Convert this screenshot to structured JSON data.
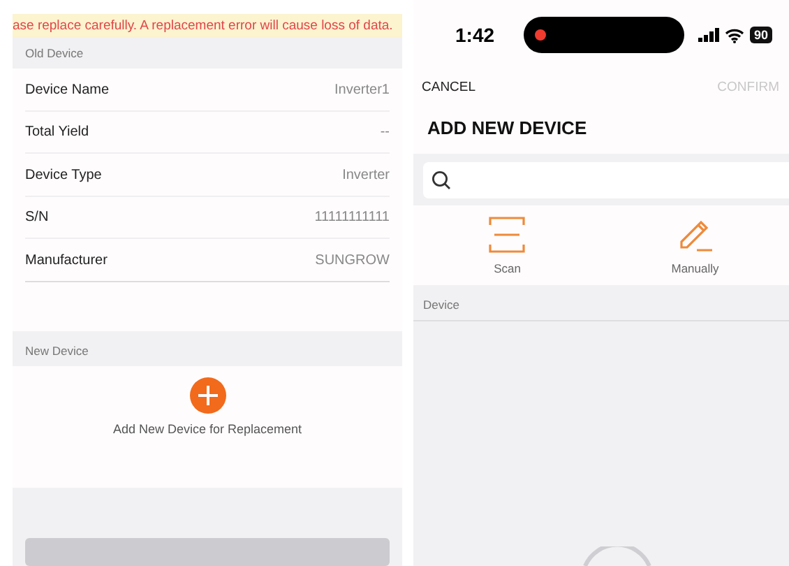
{
  "replace_screen": {
    "warning": "ase replace carefully. A replacement error will cause loss of data.",
    "old_device": {
      "header": "Old Device",
      "rows": [
        {
          "label": "Device Name",
          "value": "Inverter1"
        },
        {
          "label": "Total Yield",
          "value": "--"
        },
        {
          "label": "Device Type",
          "value": "Inverter"
        },
        {
          "label": "S/N",
          "value": "11111111111"
        },
        {
          "label": "Manufacturer",
          "value": "SUNGROW"
        }
      ]
    },
    "new_device": {
      "header": "New Device",
      "add_label": "Add New Device for Replacement"
    }
  },
  "add_screen": {
    "status_bar": {
      "time": "1:42",
      "recording": true,
      "battery": "90"
    },
    "nav": {
      "cancel": "CANCEL",
      "confirm": "CONFIRM",
      "confirm_disabled": true
    },
    "title": "ADD NEW DEVICE",
    "options": [
      {
        "kind": "scan",
        "label": "Scan"
      },
      {
        "kind": "manual",
        "label": "Manually"
      }
    ],
    "list_header": "Device",
    "loading": true
  }
}
